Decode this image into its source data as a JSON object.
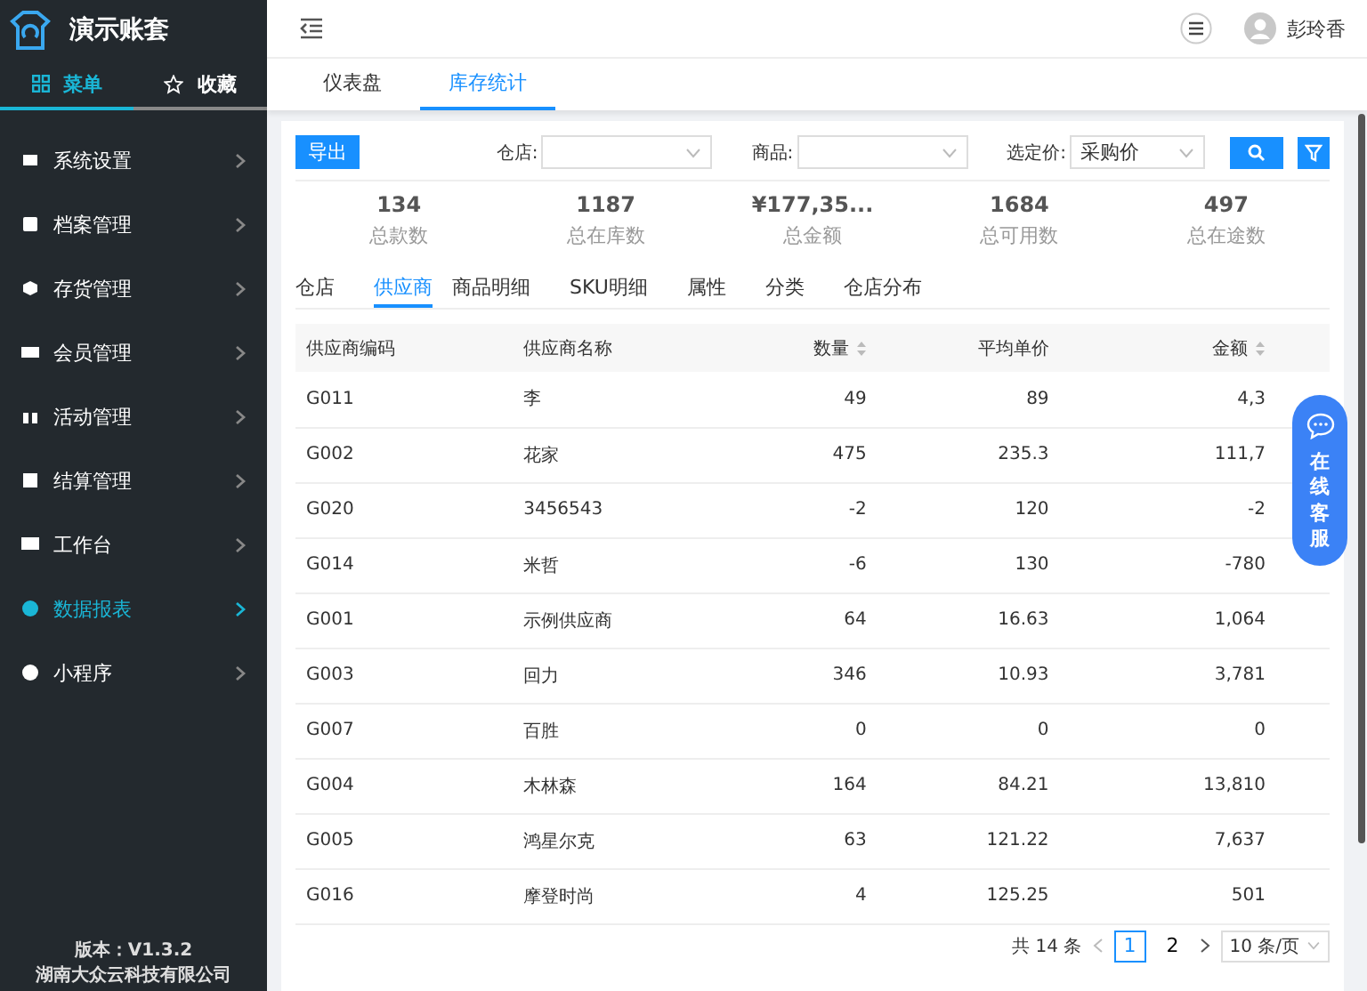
{
  "sidebar": {
    "title": "演示账套",
    "tabs": [
      {
        "kind": "menu",
        "label": "菜单",
        "selected": true
      },
      {
        "kind": "favorites",
        "label": "收藏",
        "selected": false
      }
    ],
    "items": [
      {
        "label": "系统设置",
        "selected": false
      },
      {
        "label": "档案管理",
        "selected": false
      },
      {
        "label": "存货管理",
        "selected": false
      },
      {
        "label": "会员管理",
        "selected": false
      },
      {
        "label": "活动管理",
        "selected": false
      },
      {
        "label": "结算管理",
        "selected": false
      },
      {
        "label": "工作台",
        "selected": false
      },
      {
        "label": "数据报表",
        "selected": true
      },
      {
        "label": "小程序",
        "selected": false
      }
    ],
    "version": "版本：V1.3.2",
    "company": "湖南大众云科技有限公司"
  },
  "header": {
    "user": "彭玲香"
  },
  "page_tabs": [
    {
      "label": "仪表盘",
      "selected": false
    },
    {
      "label": "库存统计",
      "selected": true
    }
  ],
  "filters": {
    "export_button": "导出",
    "fields": [
      {
        "label": "仓店:"
      },
      {
        "label": "商品:"
      },
      {
        "label": "选定价:",
        "value": "采购价"
      }
    ]
  },
  "stats": [
    {
      "value": "134",
      "label": "总款数"
    },
    {
      "value": "1187",
      "label": "总在库数"
    },
    {
      "value": "¥177,35...",
      "label": "总金额"
    },
    {
      "value": "1684",
      "label": "总可用数"
    },
    {
      "value": "497",
      "label": "总在途数"
    }
  ],
  "sub_tabs": [
    {
      "label": "仓店",
      "selected": false
    },
    {
      "label": "供应商",
      "selected": true
    },
    {
      "label": "商品明细",
      "selected": false
    },
    {
      "label": "SKU明细",
      "selected": false
    },
    {
      "label": "属性",
      "selected": false
    },
    {
      "label": "分类",
      "selected": false
    },
    {
      "label": "仓店分布",
      "selected": false
    }
  ],
  "table": {
    "columns": [
      {
        "label": "供应商编码",
        "sortable": false
      },
      {
        "label": "供应商名称",
        "sortable": false
      },
      {
        "label": "数量",
        "sortable": true
      },
      {
        "label": "平均单价",
        "sortable": false
      },
      {
        "label": "金额",
        "sortable": true
      }
    ],
    "rows": [
      [
        "G011",
        "李",
        "49",
        "89",
        "4,3"
      ],
      [
        "G002",
        "花家",
        "475",
        "235.3",
        "111,7"
      ],
      [
        "G020",
        "3456543",
        "-2",
        "120",
        "-2"
      ],
      [
        "G014",
        "米哲",
        "-6",
        "130",
        "-780"
      ],
      [
        "G001",
        "示例供应商",
        "64",
        "16.63",
        "1,064"
      ],
      [
        "G003",
        "回力",
        "346",
        "10.93",
        "3,781"
      ],
      [
        "G007",
        "百胜",
        "0",
        "0",
        "0"
      ],
      [
        "G004",
        "木林森",
        "164",
        "84.21",
        "13,810"
      ],
      [
        "G005",
        "鸿星尔克",
        "63",
        "121.22",
        "7,637"
      ],
      [
        "G016",
        "摩登时尚",
        "4",
        "125.25",
        "501"
      ]
    ]
  },
  "pagination": {
    "total": "共 14 条",
    "pages": [
      {
        "label": "1",
        "selected": true
      },
      {
        "label": "2",
        "selected": false
      }
    ],
    "page_size": "10 条/页"
  },
  "chat_widget": {
    "label": "在线客服"
  }
}
